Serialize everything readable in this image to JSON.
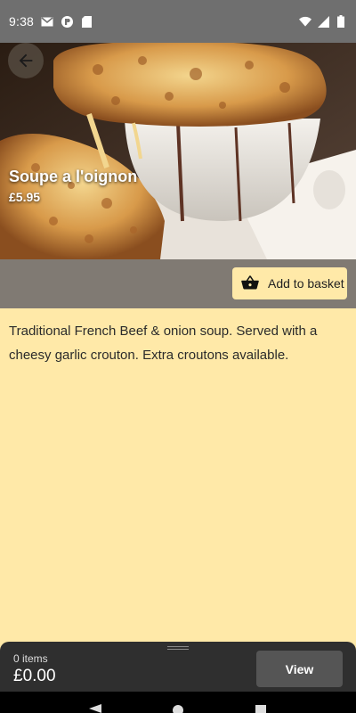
{
  "status_bar": {
    "time": "9:38",
    "left_icons": [
      "gmail-icon",
      "notification-icon",
      "sd-card-icon"
    ],
    "right_icons": [
      "wifi-icon",
      "signal-icon",
      "battery-icon"
    ]
  },
  "item": {
    "title": "Soupe a l'oignon",
    "price": "£5.95",
    "description": "Traditional French Beef & onion soup. Served with a cheesy garlic crouton. Extra croutons available."
  },
  "actions": {
    "add_to_basket_label": "Add to basket"
  },
  "basket": {
    "items_label": "0 items",
    "total": "£0.00",
    "view_label": "View"
  },
  "colors": {
    "background": "#ffe9a8",
    "status_bar": "#6f6f6f",
    "action_strip": "#807a73",
    "basket_sheet": "#2f2f2f"
  }
}
